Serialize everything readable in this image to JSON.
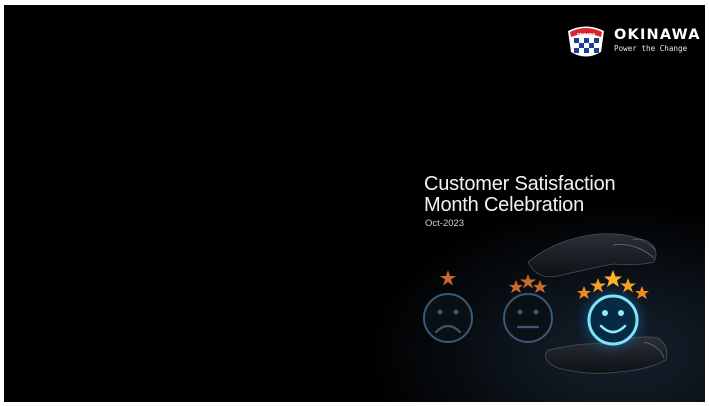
{
  "slide": {
    "background_color": "#000000",
    "title_line_1": "Customer Satisfaction",
    "title_line_2": "Month Celebration",
    "date": "Oct-2023"
  },
  "brand": {
    "name": "OKINAWA",
    "tagline": "Power the Change",
    "emblem_text": "OKINAWA",
    "accent_color": "#d7262e"
  },
  "illustration": {
    "faces": [
      {
        "mood": "sad",
        "stars": 1,
        "icon": "sad-face-icon"
      },
      {
        "mood": "neutral",
        "stars": 3,
        "icon": "neutral-face-icon"
      },
      {
        "mood": "happy",
        "stars": 5,
        "icon": "happy-face-icon"
      }
    ],
    "star_color": "#e07a20",
    "face_color": "#3b5876",
    "glow_color": "#39c6ff"
  }
}
